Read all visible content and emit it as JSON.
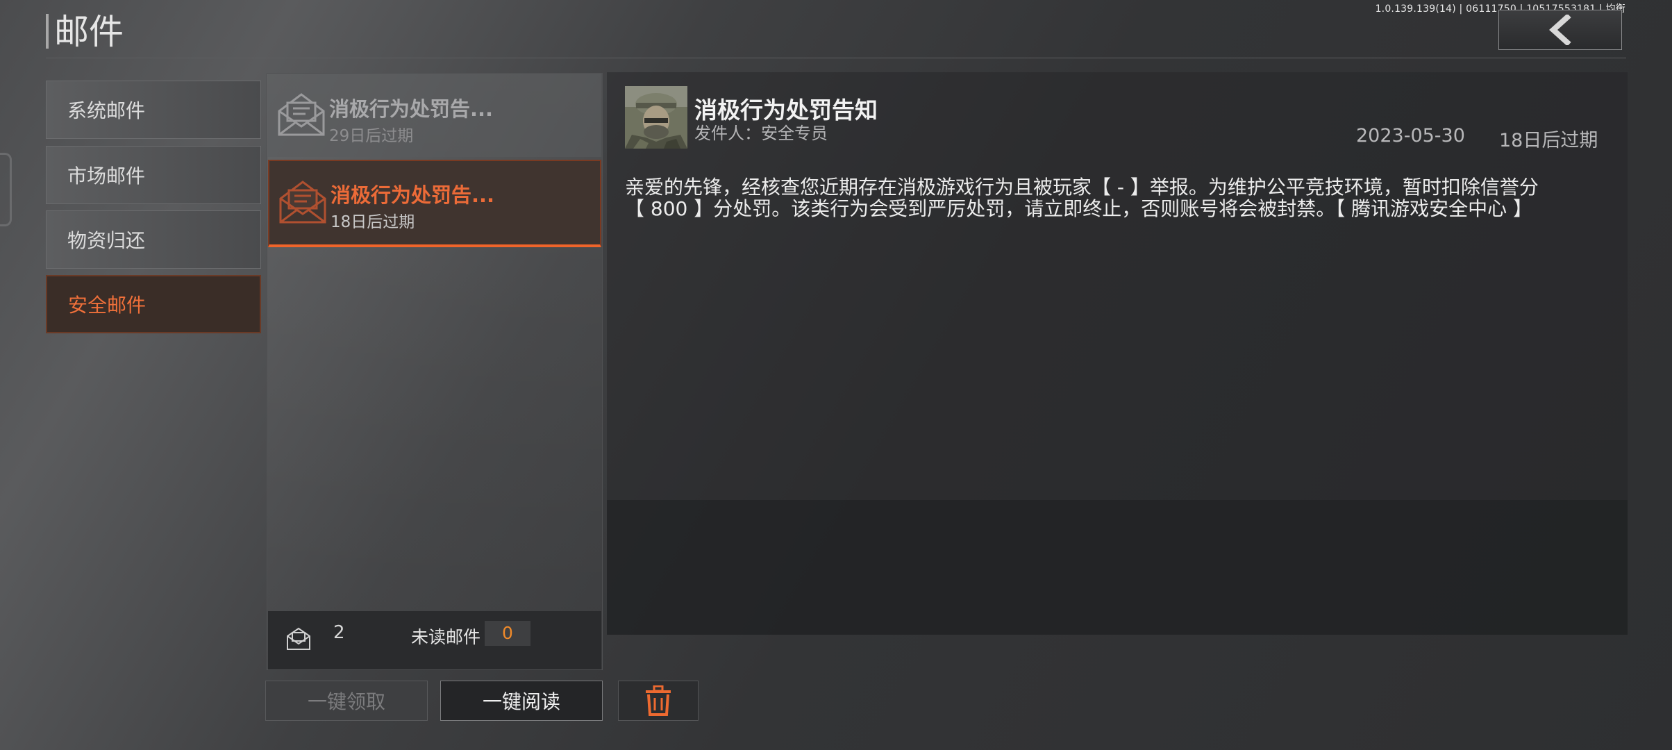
{
  "header": {
    "title": "邮件",
    "version": "1.0.139.139(14) | 06111750 | 10517553181 | 均衡"
  },
  "categories": [
    {
      "label": "系统邮件",
      "active": false
    },
    {
      "label": "市场邮件",
      "active": false
    },
    {
      "label": "物资归还",
      "active": false
    },
    {
      "label": "安全邮件",
      "active": true
    }
  ],
  "mail_list": {
    "items": [
      {
        "title": "消极行为处罚告...",
        "expiry": "29日后过期",
        "selected": false
      },
      {
        "title": "消极行为处罚告...",
        "expiry": "18日后过期",
        "selected": true
      }
    ],
    "footer": {
      "total_count": "2",
      "unread_label": "未读邮件",
      "unread_count": "0"
    }
  },
  "buttons": {
    "claim_all": "一键领取",
    "read_all": "一键阅读"
  },
  "detail": {
    "subject": "消极行为处罚告知",
    "sender": "发件人：安全专员",
    "date": "2023-05-30",
    "expiry": "18日后过期",
    "body_line1": "亲爱的先锋，经核查您近期存在消极游戏行为且被玩家【 - 】举报。为维护公平竞技环境，暂时扣除信誉分",
    "body_line2": "【 800 】分处罚。该类行为会受到严厉处罚，请立即终止，否则账号将会被封禁。【 腾讯游戏安全中心 】"
  },
  "colors": {
    "accent": "#f0642a",
    "unread_count": "#f08a2a"
  },
  "icons": {
    "back": "chevron-left-icon",
    "mail": "envelope-open-icon",
    "delete": "trash-icon"
  }
}
